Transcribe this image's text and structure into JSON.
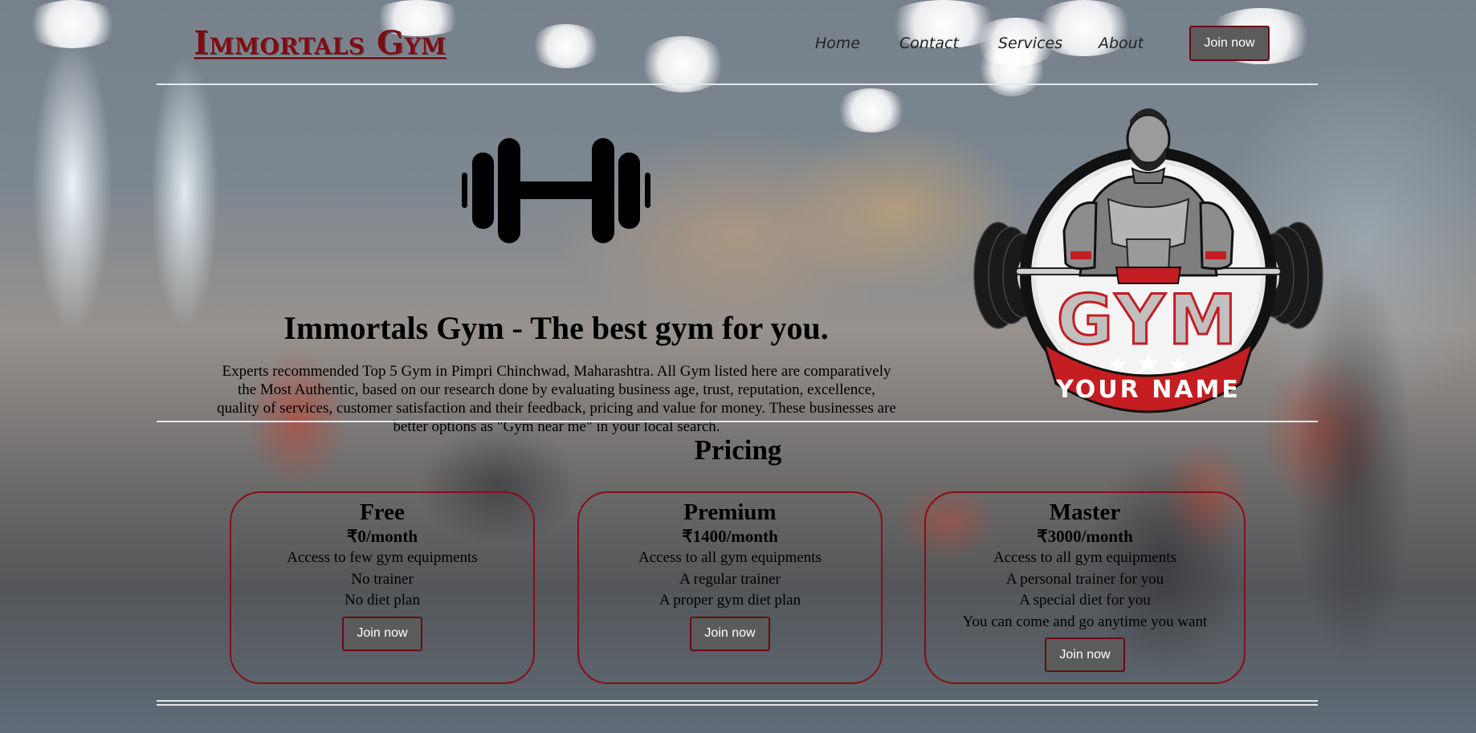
{
  "header": {
    "brand": "Immortals Gym",
    "nav": [
      "Home",
      "Contact",
      "Services",
      "About"
    ],
    "join_label": "Join now"
  },
  "hero": {
    "icon": "dumbbell-icon",
    "title": "Immortals Gym - The best gym for you.",
    "description": "Experts recommended Top 5 Gym in Pimpri Chinchwad, Maharashtra. All Gym listed here are comparatively the Most Authentic, based on our research done by evaluating business age, trust, reputation, excellence, quality of services, customer satisfaction and their feedback, pricing and value for money. These businesses are better options as \"Gym near me\" in your local search."
  },
  "logo": {
    "icon": "gym-logo-bodybuilder",
    "word": "GYM",
    "tagline": "YOUR NAME"
  },
  "pricing": {
    "title": "Pricing",
    "plans": [
      {
        "name": "Free",
        "price": "₹0/month",
        "features": [
          "Access to few gym equipments",
          "No trainer",
          "No diet plan"
        ],
        "button": "Join now"
      },
      {
        "name": "Premium",
        "price": "₹1400/month",
        "features": [
          "Access to all gym equipments",
          "A regular trainer",
          "A proper gym diet plan"
        ],
        "button": "Join now"
      },
      {
        "name": "Master",
        "price": "₹3000/month",
        "features": [
          "Access to all gym equipments",
          "A personal trainer for you",
          "A special diet for you",
          "You can come and go anytime you want"
        ],
        "button": "Join now"
      }
    ]
  },
  "colors": {
    "brand": "#7a0e15",
    "card_border": "#8a0d15",
    "button_bg": "#5b5b5b",
    "divider": "#e6e8ea"
  }
}
